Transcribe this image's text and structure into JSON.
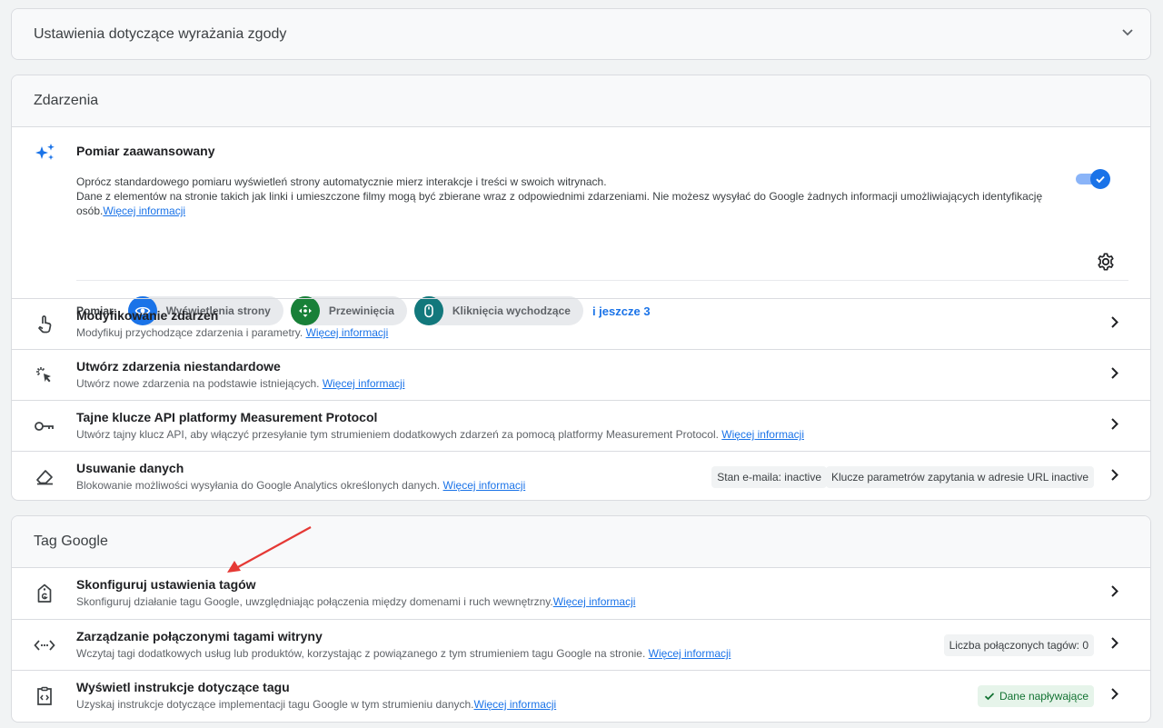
{
  "consent": {
    "title": "Ustawienia dotyczące wyrażania zgody"
  },
  "events": {
    "title": "Zdarzenia",
    "enhanced": {
      "title": "Pomiar zaawansowany",
      "desc_line1": "Oprócz standardowego pomiaru wyświetleń strony automatycznie mierz interakcje i treści w swoich witrynach.",
      "desc_line2": "Dane z elementów na stronie takich jak linki i umieszczone filmy mogą być zbierane wraz z odpowiednimi zdarzeniami. Nie możesz wysyłać do Google żadnych informacji umożliwiających identyfikację osób.",
      "link": "Więcej informacji",
      "toggle_on": true,
      "measure_label": "Pomiar:",
      "chips": [
        {
          "label": "Wyświetlenia strony",
          "color": "#1a73e8",
          "icon": "eye-icon"
        },
        {
          "label": "Przewinięcia",
          "color": "#188038",
          "icon": "scroll-icon"
        },
        {
          "label": "Kliknięcia wychodzące",
          "color": "#12787c",
          "icon": "mouse-icon"
        }
      ],
      "more": "i jeszcze 3"
    },
    "rows": [
      {
        "title": "Modyfikowanie zdarzeń",
        "desc": "Modyfikuj przychodzące zdarzenia i parametry.",
        "link": "Więcej informacji",
        "icon": "touch-icon"
      },
      {
        "title": "Utwórz zdarzenia niestandardowe",
        "desc": "Utwórz nowe zdarzenia na podstawie istniejących.",
        "link": "Więcej informacji",
        "icon": "click-icon"
      },
      {
        "title": "Tajne klucze API platformy Measurement Protocol",
        "desc": "Utwórz tajny klucz API, aby włączyć przesyłanie tym strumieniem dodatkowych zdarzeń za pomocą platformy Measurement Protocol.",
        "link": "Więcej informacji",
        "icon": "key-icon"
      },
      {
        "title": "Usuwanie danych",
        "desc": "Blokowanie możliwości wysyłania do Google Analytics określonych danych.",
        "link": "Więcej informacji",
        "icon": "eraser-icon",
        "badge1": "Stan e-maila: inactive",
        "badge2": "Klucze parametrów zapytania w adresie URL inactive"
      }
    ]
  },
  "tag": {
    "title": "Tag Google",
    "rows": [
      {
        "title": "Skonfiguruj ustawienia tagów",
        "desc": "Skonfiguruj działanie tagu Google, uwzględniając połączenia między domenami i ruch wewnętrzny.",
        "link": "Więcej informacji",
        "icon": "tag-icon"
      },
      {
        "title": "Zarządzanie połączonymi tagami witryny",
        "desc": "Wczytaj tagi dodatkowych usług lub produktów, korzystając z powiązanego z tym strumieniem tagu Google na stronie.",
        "link": "Więcej informacji",
        "icon": "code-icon",
        "badge": "Liczba połączonych tagów: 0"
      },
      {
        "title": "Wyświetl instrukcje dotyczące tagu",
        "desc": "Uzyskaj instrukcje dotyczące implementacji tagu Google w tym strumieniu danych.",
        "link": "Więcej informacji",
        "icon": "instructions-icon",
        "badge": "Dane napływające"
      }
    ]
  }
}
